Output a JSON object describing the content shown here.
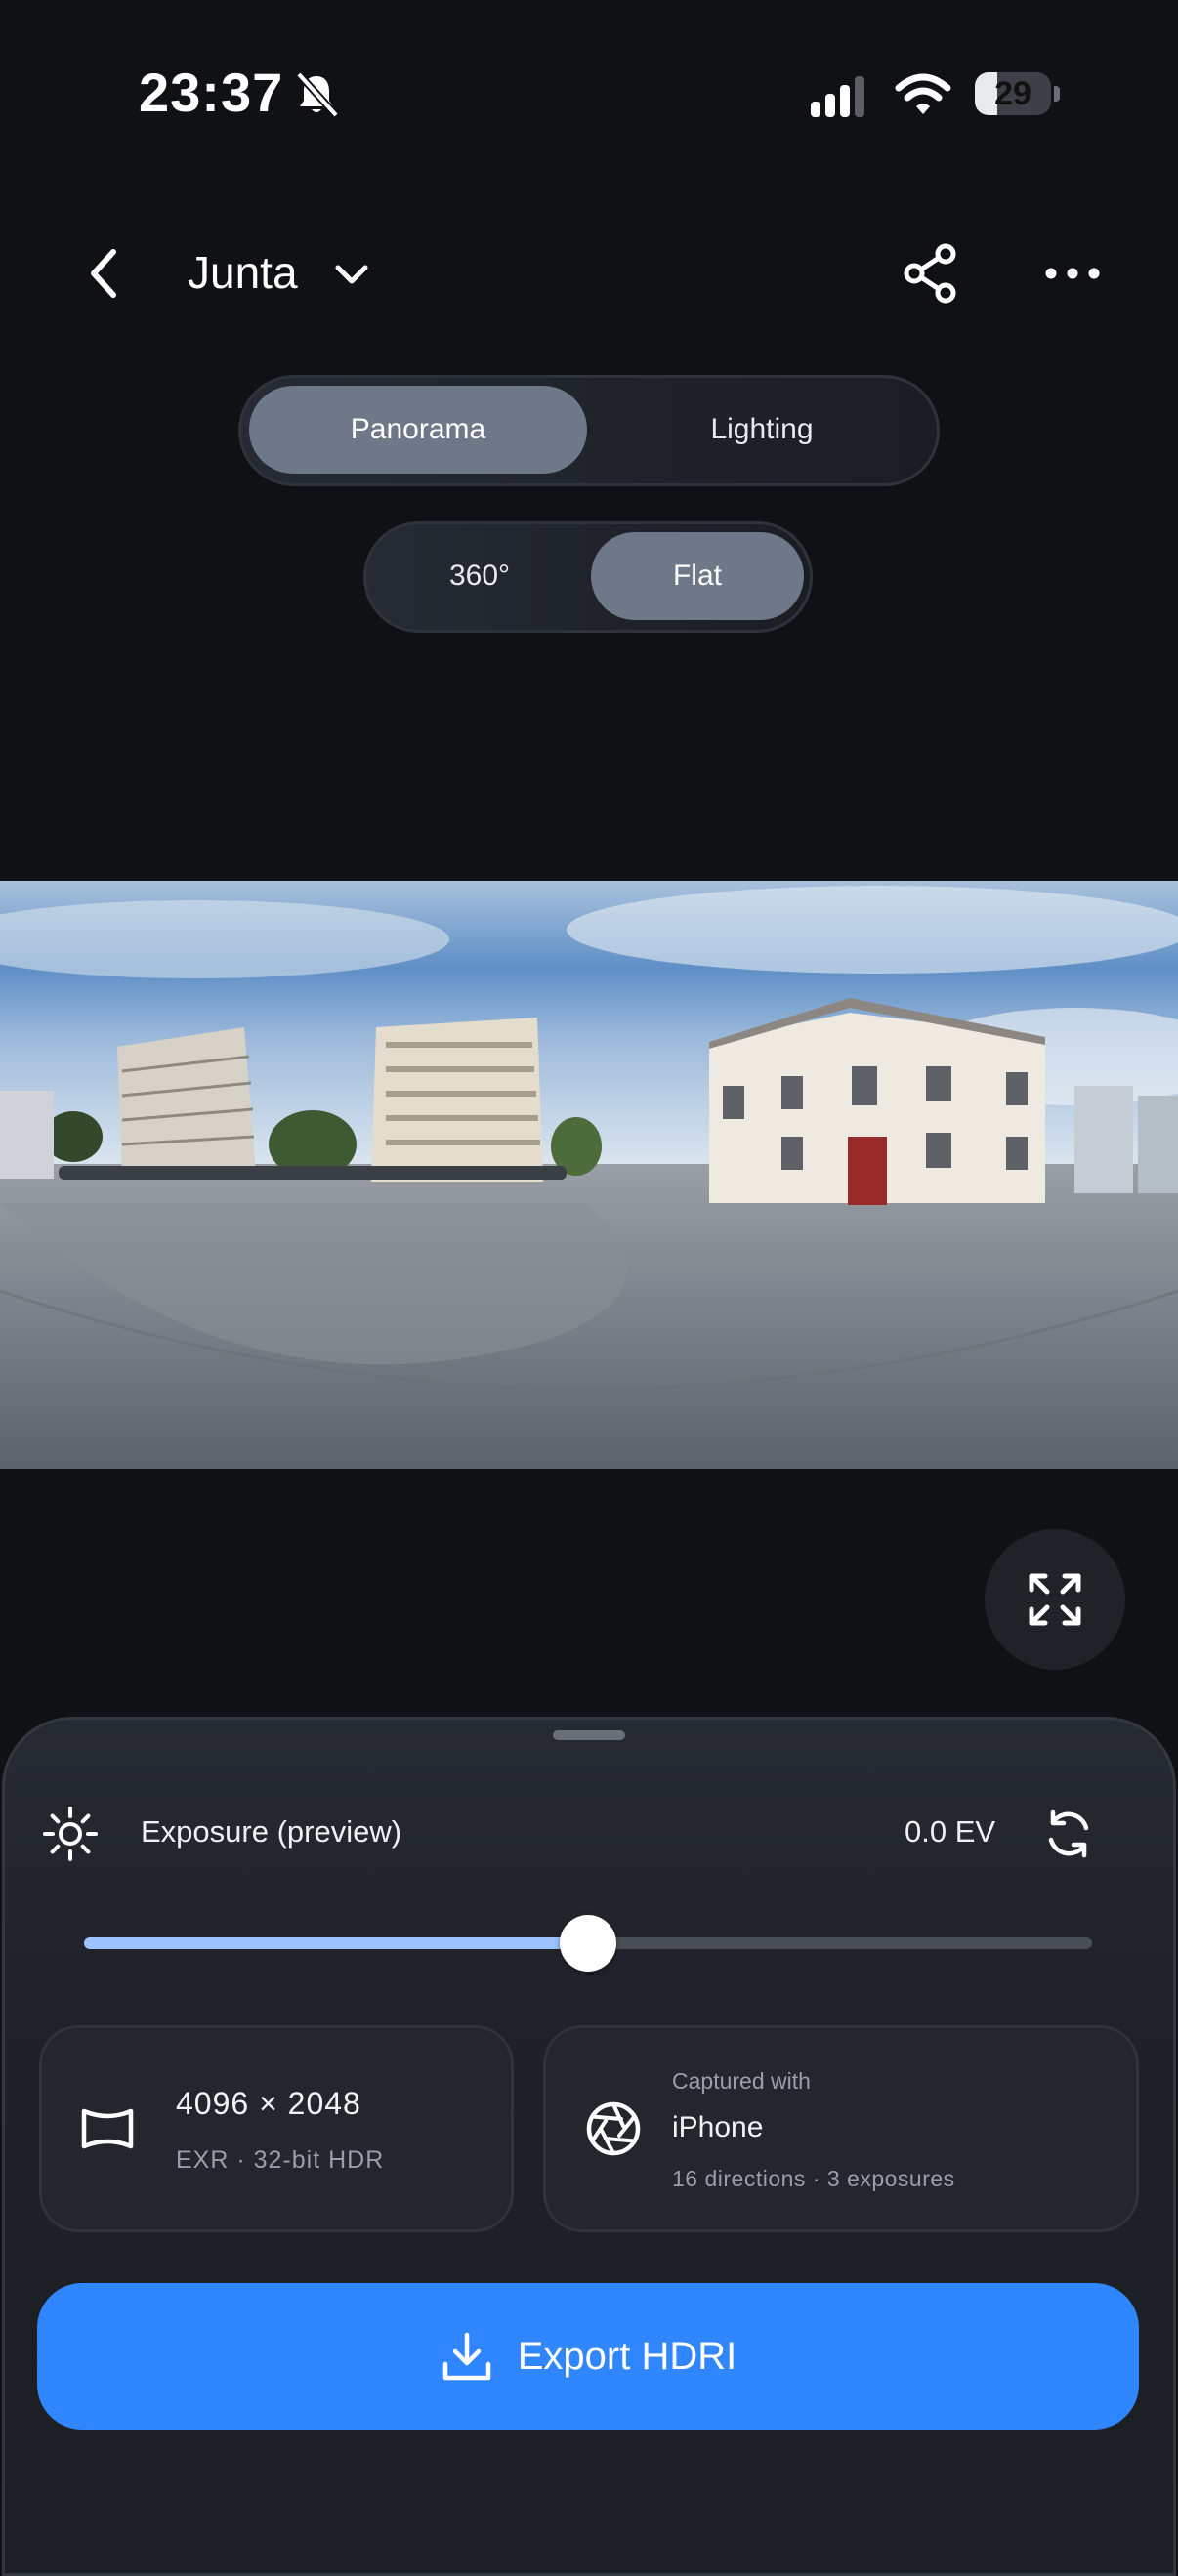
{
  "status_bar": {
    "time": "23:37",
    "battery_level": "29",
    "battery_fraction": 0.29,
    "icons": [
      "bell-slash-icon",
      "signal-icon",
      "wifi-icon",
      "battery-icon"
    ]
  },
  "header": {
    "title": "Junta",
    "icons": [
      "chevron-left-icon",
      "chevron-down-icon",
      "share-icon",
      "more-icon"
    ]
  },
  "view_mode": {
    "options": [
      "Panorama",
      "Lighting"
    ],
    "selected": "Panorama"
  },
  "projection": {
    "options": [
      "360°",
      "Flat"
    ],
    "selected": "Flat"
  },
  "exposure": {
    "label": "Exposure (preview)",
    "value": "0.0 EV",
    "slider_fraction": 0.5
  },
  "resolution_card": {
    "value": "4096 × 2048",
    "format": "EXR · 32-bit HDR"
  },
  "capture_card": {
    "label": "Captured with",
    "device": "iPhone",
    "details": "16 directions · 3 exposures"
  },
  "export_button": {
    "label": "Export HDRI"
  },
  "colors": {
    "background": "#0f1115",
    "accent": "#2f86ff",
    "slider_fill": "#9dc2ff",
    "segment_selected": "#6f7888"
  }
}
